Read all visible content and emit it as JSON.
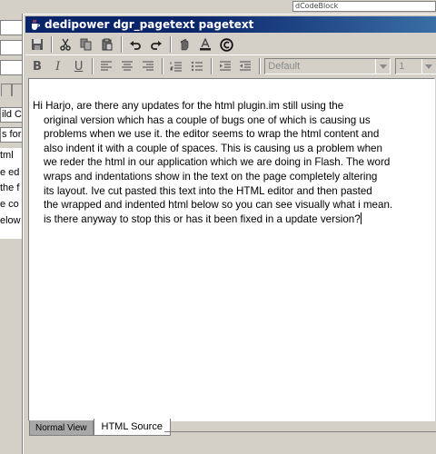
{
  "background": {
    "top_right_text": "dCodeBlock",
    "left_text_lines": [
      "tml",
      "e ed",
      "the f",
      "e co",
      "elow"
    ],
    "left_label_1": "ild C",
    "left_label_2": "s for"
  },
  "window": {
    "title": "dedipower dgr_pagetext pagetext"
  },
  "toolbar1": {
    "buttons": [
      "save-icon",
      "cut-icon",
      "copy-icon",
      "paste-icon",
      "undo-icon",
      "redo-icon",
      "hand-icon",
      "text-color-icon",
      "copyright-icon"
    ]
  },
  "toolbar2": {
    "font_select_value": "Default",
    "size_select_value": "1"
  },
  "editor": {
    "first_line": "Hi Harjo, are there any updates for the html plugin.im still using the",
    "lines": [
      "original version which has a couple of bugs one of which is causing us",
      "problems when we use it. the editor seems to wrap the html content and",
      "also indent it with a couple of spaces. This is causing us a problem when",
      "we reder the html in our application which we are doing in Flash. The word",
      "wraps and indentations show in the text on the page completely altering",
      "its layout. Ive cut pasted this text into the HTML editor and then pasted",
      "the wrapped and indented html below so you can see visually what i mean.",
      "is there anyway to stop this or has it been fixed in a update version?"
    ]
  },
  "tabs": {
    "normal_view": "Normal View",
    "html_source": "HTML Source"
  },
  "colors": {
    "titlebar": "#0a246a",
    "chrome": "#d4d0c8"
  }
}
